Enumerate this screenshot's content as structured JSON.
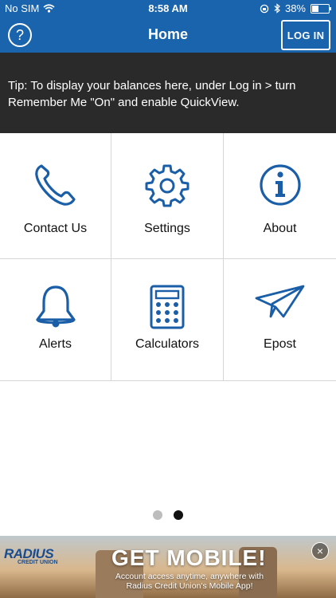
{
  "status_bar": {
    "carrier": "No SIM",
    "time": "8:58 AM",
    "battery": "38%",
    "battery_level": 0.38
  },
  "header": {
    "help_symbol": "?",
    "title": "Home",
    "login_label": "LOG IN",
    "color": "#1a63ad"
  },
  "tip": {
    "text": "Tip: To display your balances here, under Log in > turn Remember Me \"On\" and enable QuickView."
  },
  "tiles": [
    {
      "label": "Contact Us",
      "icon": "phone-icon"
    },
    {
      "label": "Settings",
      "icon": "gear-icon"
    },
    {
      "label": "About",
      "icon": "info-icon"
    },
    {
      "label": "Alerts",
      "icon": "bell-icon"
    },
    {
      "label": "Calculators",
      "icon": "calculator-icon"
    },
    {
      "label": "Epost",
      "icon": "paper-plane-icon"
    }
  ],
  "pager": {
    "count": 2,
    "active": 2
  },
  "ad": {
    "brand": "RADIUS",
    "brand_sub": "CREDIT UNION",
    "headline": "GET MOBILE!",
    "subtext": "Account access anytime, anywhere with Radius Credit Union's Mobile App!",
    "close_symbol": "×"
  },
  "icon_color": "#1a5ea8"
}
